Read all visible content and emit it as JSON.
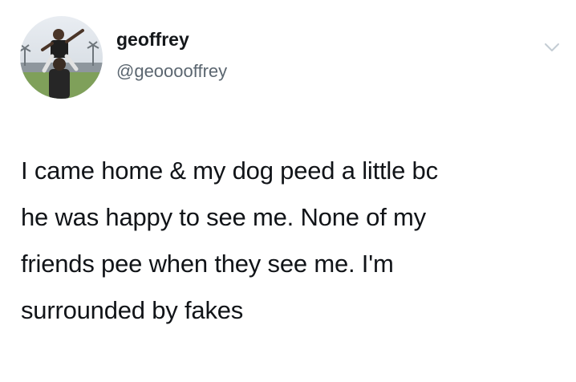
{
  "tweet": {
    "author": {
      "display_name": "geoffrey",
      "handle": "@geooooffrey",
      "avatar_icon": "profile-photo"
    },
    "menu_icon": "chevron-down-icon",
    "text_lines": [
      "I came home & my dog peed a little bc",
      "he was happy to see me. None of my",
      "friends pee when they see me. I'm",
      "surrounded by fakes"
    ]
  },
  "colors": {
    "name_text": "#14171a",
    "handle_text": "#5b6670",
    "body_text": "#111418",
    "chevron": "#c4ccd4"
  }
}
